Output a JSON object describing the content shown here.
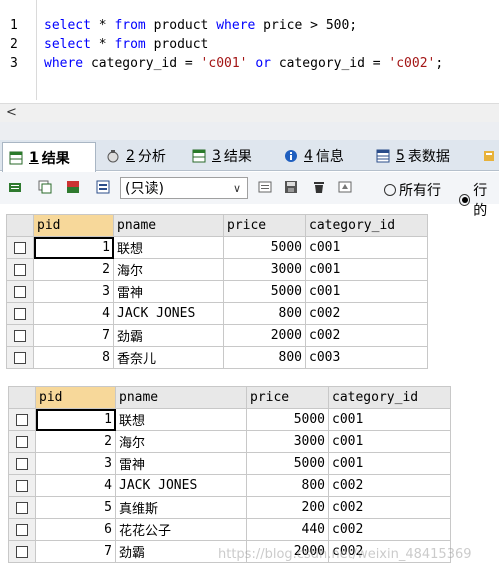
{
  "editor": {
    "line_numbers": [
      "1",
      "2",
      "3"
    ],
    "lines": [
      [
        {
          "t": "select",
          "k": "kw"
        },
        {
          "t": " * ",
          "k": ""
        },
        {
          "t": "from",
          "k": "kw"
        },
        {
          "t": " product ",
          "k": ""
        },
        {
          "t": "where",
          "k": "kw"
        },
        {
          "t": " price > ",
          "k": ""
        },
        {
          "t": "500",
          "k": "num"
        },
        {
          "t": ";",
          "k": ""
        }
      ],
      [
        {
          "t": "select",
          "k": "kw"
        },
        {
          "t": " * ",
          "k": ""
        },
        {
          "t": "from",
          "k": "kw"
        },
        {
          "t": " product",
          "k": ""
        }
      ],
      [
        {
          "t": "where",
          "k": "kw"
        },
        {
          "t": " category_id = ",
          "k": ""
        },
        {
          "t": "'c001'",
          "k": "str"
        },
        {
          "t": " ",
          "k": ""
        },
        {
          "t": "or",
          "k": "kw"
        },
        {
          "t": " category_id = ",
          "k": ""
        },
        {
          "t": "'c002'",
          "k": "str"
        },
        {
          "t": ";",
          "k": ""
        }
      ]
    ],
    "scroll_left_arrow": "<"
  },
  "tabs": [
    {
      "num": "1",
      "label": "结果",
      "active": true,
      "icon": "result-grid-icon"
    },
    {
      "num": "2",
      "label": "分析",
      "active": false,
      "icon": "profiler-icon"
    },
    {
      "num": "3",
      "label": "结果",
      "active": false,
      "icon": "result-grid-icon"
    },
    {
      "num": "4",
      "label": "信息",
      "active": false,
      "icon": "info-icon"
    },
    {
      "num": "5",
      "label": "表数据",
      "active": false,
      "icon": "table-data-icon"
    }
  ],
  "toolbar": {
    "mode_select": "(只读)",
    "radio_all_rows": "○所有行",
    "radio_rows_label": "所有行",
    "radio_rows2_label": "行的"
  },
  "grid1": {
    "columns": [
      "pid",
      "pname",
      "price",
      "category_id"
    ],
    "rows": [
      [
        "1",
        "联想",
        "5000",
        "c001"
      ],
      [
        "2",
        "海尔",
        "3000",
        "c001"
      ],
      [
        "3",
        "雷神",
        "5000",
        "c001"
      ],
      [
        "4",
        "JACK JONES",
        "800",
        "c002"
      ],
      [
        "7",
        "劲霸",
        "2000",
        "c002"
      ],
      [
        "8",
        "香奈儿",
        "800",
        "c003"
      ]
    ]
  },
  "grid2": {
    "columns": [
      "pid",
      "pname",
      "price",
      "category_id"
    ],
    "rows": [
      [
        "1",
        "联想",
        "5000",
        "c001"
      ],
      [
        "2",
        "海尔",
        "3000",
        "c001"
      ],
      [
        "3",
        "雷神",
        "5000",
        "c001"
      ],
      [
        "4",
        "JACK JONES",
        "800",
        "c002"
      ],
      [
        "5",
        "真维斯",
        "200",
        "c002"
      ],
      [
        "6",
        "花花公子",
        "440",
        "c002"
      ],
      [
        "7",
        "劲霸",
        "2000",
        "c002"
      ]
    ]
  },
  "watermark": "https://blog.csdn.net/weixin_48415369",
  "colors": {
    "keyword": "#0000ff",
    "string": "#a31515",
    "sorted_header": "#f7d89a"
  }
}
